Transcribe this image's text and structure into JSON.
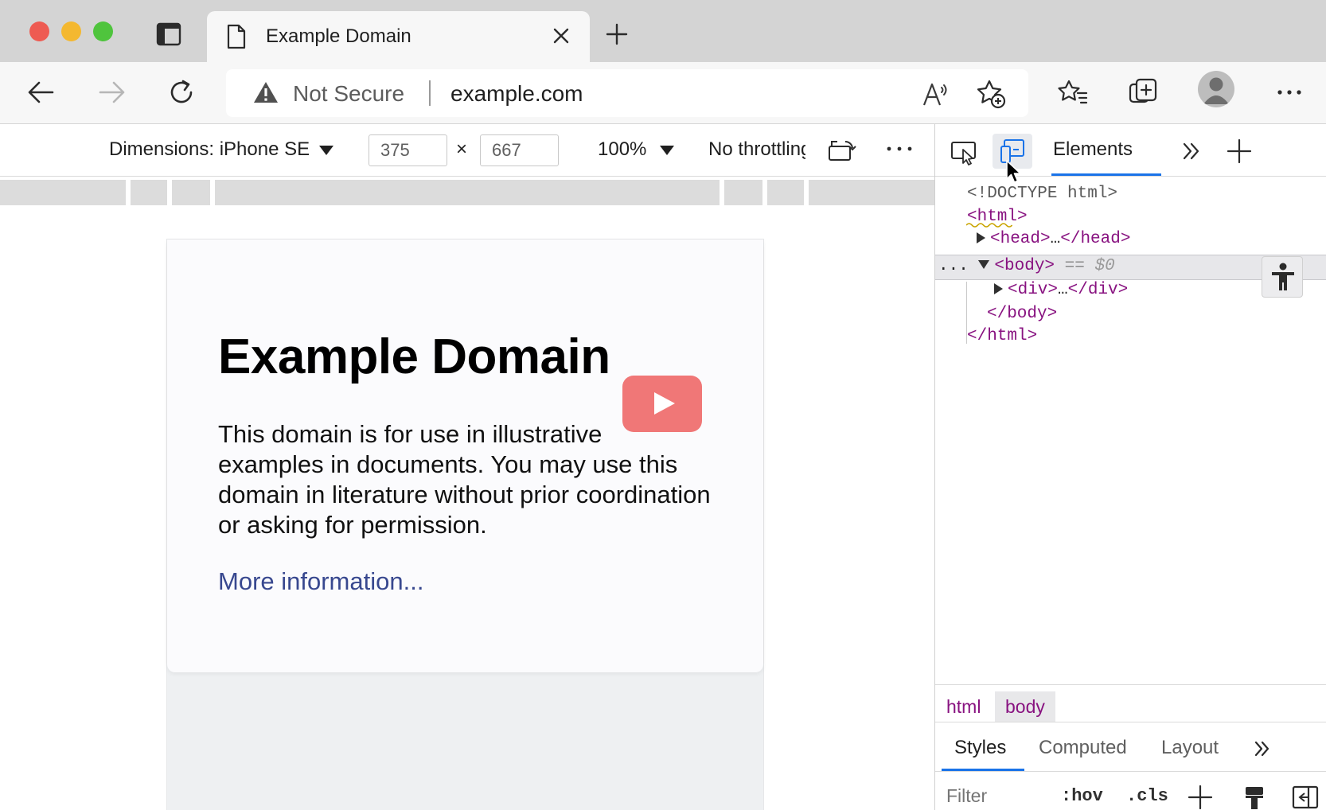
{
  "browser": {
    "tab": {
      "title": "Example Domain"
    },
    "address": {
      "security": "Not Secure",
      "url": "example.com"
    }
  },
  "device_toolbar": {
    "dimensions_label": "Dimensions: iPhone SE",
    "width": "375",
    "height": "667",
    "times": "×",
    "zoom": "100%",
    "throttling": "No throttling"
  },
  "page": {
    "title": "Example Domain",
    "paragraph": "This domain is for use in illustrative examples in documents. You may use this domain in literature without prior coordination or asking for permission.",
    "link": "More information..."
  },
  "devtools": {
    "tabs": {
      "elements": "Elements"
    },
    "dom": {
      "doctype": "<!DOCTYPE html>",
      "html_open": "<html>",
      "head": "<head>",
      "head_ellipsis": "…",
      "head_close": "</head>",
      "row_dots": "...",
      "body_open": "<body>",
      "body_eq": "==",
      "body_var": "$0",
      "div": "<div>",
      "div_ellipsis": "…",
      "div_close": "</div>",
      "body_close": "</body>",
      "html_close": "</html>"
    },
    "breadcrumbs": [
      "html",
      "body"
    ],
    "subtabs": [
      "Styles",
      "Computed",
      "Layout"
    ],
    "styles_toolbar": {
      "filter_placeholder": "Filter",
      "hov": ":hov",
      "cls": ".cls"
    }
  },
  "colors": {
    "accent": "#1a73e8",
    "tag": "#881280",
    "link": "#38488f",
    "youtube_play": "#f07777"
  },
  "icons": [
    "tab-actions-icon",
    "page-icon",
    "close-icon",
    "plus-icon",
    "back-icon",
    "forward-icon",
    "refresh-icon",
    "warning-icon",
    "read-aloud-icon",
    "favorite-add-icon",
    "favorites-icon",
    "collections-icon",
    "profile-icon",
    "more-icon",
    "rotate-icon",
    "inspect-icon",
    "device-emulation-icon",
    "more-tabs-icon",
    "accessibility-icon",
    "play-icon",
    "paint-brush-icon",
    "sidebar-toggle-icon"
  ]
}
